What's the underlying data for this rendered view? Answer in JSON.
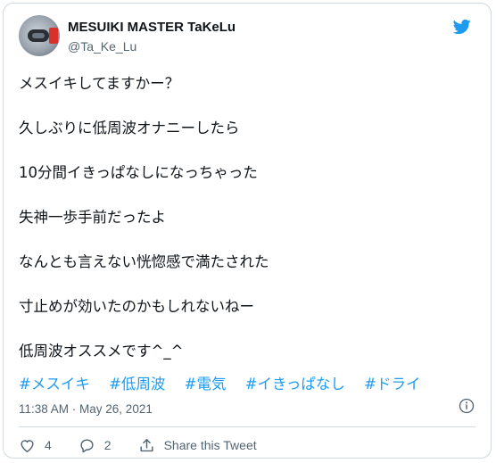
{
  "tweet": {
    "display_name": "MESUIKI MASTER TaKeLu",
    "handle": "@Ta_Ke_Lu",
    "lines": [
      "メスイキしてますかー？",
      "久しぶりに低周波オナニーしたら",
      "10分間イきっぱなしになっちゃった",
      "失神一歩手前だったよ",
      "なんとも言えない恍惚感で満たされた",
      "寸止めが効いたのかもしれないねー",
      "低周波オススメです^_^"
    ],
    "hashtags": [
      "#メスイキ",
      "#低周波",
      "#電気",
      "#イきっぱなし",
      "#ドライ"
    ],
    "timestamp": "11:38 AM · May 26, 2021",
    "likes": "4",
    "replies": "2",
    "share_label": "Share this Tweet"
  },
  "colors": {
    "accent": "#1d9bf0",
    "muted": "#536471",
    "text": "#0f1419",
    "border": "#cfd9de"
  },
  "icons": {
    "brand": "twitter-bird-icon",
    "info": "info-icon",
    "like": "heart-icon",
    "reply": "reply-icon",
    "share": "share-icon"
  }
}
